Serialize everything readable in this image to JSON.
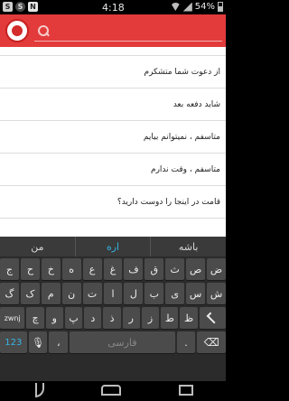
{
  "status_bar": {
    "time": "4:18",
    "battery": "54%",
    "icons": [
      "s-icon",
      "skype-icon",
      "n-icon",
      "wifi-icon",
      "signal-icon",
      "battery-icon"
    ],
    "icon_glyphs": {
      "s": "S",
      "skype": "S",
      "n": "N"
    }
  },
  "app_bar": {
    "logo_icon": "app-logo-icon",
    "search_placeholder": "",
    "accent_color": "#e33b3b"
  },
  "messages": [
    "",
    "از دعوت شما متشکرم",
    "شاید دفعه بعد",
    "متاسفم ، نمیتوانم بیایم",
    "متاسفم ، وقت ندارم",
    "قامت در اینجا را دوست دارید؟"
  ],
  "keyboard": {
    "suggestions": [
      "باشه",
      "اره",
      "من"
    ],
    "row1": [
      "ض",
      "ص",
      "ث",
      "ق",
      "ف",
      "غ",
      "ع",
      "ه",
      "خ",
      "ح",
      "ج"
    ],
    "row2": [
      "ش",
      "س",
      "ی",
      "ب",
      "ل",
      "ا",
      "ت",
      "ن",
      "م",
      "ک",
      "گ"
    ],
    "row3": [
      "zwnj",
      "ظ",
      "ط",
      "ز",
      "ر",
      "ذ",
      "د",
      "پ",
      "و",
      "چ"
    ],
    "row4": {
      "numbers": "123",
      "space": "فارسی"
    },
    "accent_color": "#35b5e5"
  }
}
